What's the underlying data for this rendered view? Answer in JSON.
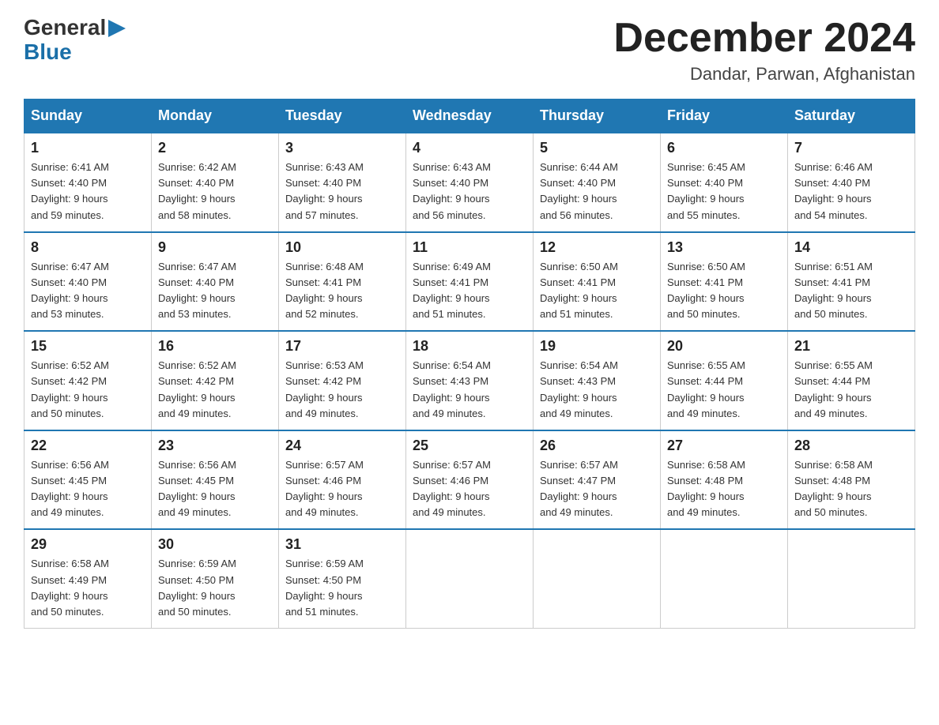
{
  "header": {
    "logo_general": "General",
    "logo_blue": "Blue",
    "month_year": "December 2024",
    "location": "Dandar, Parwan, Afghanistan"
  },
  "weekdays": [
    "Sunday",
    "Monday",
    "Tuesday",
    "Wednesday",
    "Thursday",
    "Friday",
    "Saturday"
  ],
  "weeks": [
    [
      {
        "day": "1",
        "sunrise": "6:41 AM",
        "sunset": "4:40 PM",
        "daylight": "9 hours and 59 minutes."
      },
      {
        "day": "2",
        "sunrise": "6:42 AM",
        "sunset": "4:40 PM",
        "daylight": "9 hours and 58 minutes."
      },
      {
        "day": "3",
        "sunrise": "6:43 AM",
        "sunset": "4:40 PM",
        "daylight": "9 hours and 57 minutes."
      },
      {
        "day": "4",
        "sunrise": "6:43 AM",
        "sunset": "4:40 PM",
        "daylight": "9 hours and 56 minutes."
      },
      {
        "day": "5",
        "sunrise": "6:44 AM",
        "sunset": "4:40 PM",
        "daylight": "9 hours and 56 minutes."
      },
      {
        "day": "6",
        "sunrise": "6:45 AM",
        "sunset": "4:40 PM",
        "daylight": "9 hours and 55 minutes."
      },
      {
        "day": "7",
        "sunrise": "6:46 AM",
        "sunset": "4:40 PM",
        "daylight": "9 hours and 54 minutes."
      }
    ],
    [
      {
        "day": "8",
        "sunrise": "6:47 AM",
        "sunset": "4:40 PM",
        "daylight": "9 hours and 53 minutes."
      },
      {
        "day": "9",
        "sunrise": "6:47 AM",
        "sunset": "4:40 PM",
        "daylight": "9 hours and 53 minutes."
      },
      {
        "day": "10",
        "sunrise": "6:48 AM",
        "sunset": "4:41 PM",
        "daylight": "9 hours and 52 minutes."
      },
      {
        "day": "11",
        "sunrise": "6:49 AM",
        "sunset": "4:41 PM",
        "daylight": "9 hours and 51 minutes."
      },
      {
        "day": "12",
        "sunrise": "6:50 AM",
        "sunset": "4:41 PM",
        "daylight": "9 hours and 51 minutes."
      },
      {
        "day": "13",
        "sunrise": "6:50 AM",
        "sunset": "4:41 PM",
        "daylight": "9 hours and 50 minutes."
      },
      {
        "day": "14",
        "sunrise": "6:51 AM",
        "sunset": "4:41 PM",
        "daylight": "9 hours and 50 minutes."
      }
    ],
    [
      {
        "day": "15",
        "sunrise": "6:52 AM",
        "sunset": "4:42 PM",
        "daylight": "9 hours and 50 minutes."
      },
      {
        "day": "16",
        "sunrise": "6:52 AM",
        "sunset": "4:42 PM",
        "daylight": "9 hours and 49 minutes."
      },
      {
        "day": "17",
        "sunrise": "6:53 AM",
        "sunset": "4:42 PM",
        "daylight": "9 hours and 49 minutes."
      },
      {
        "day": "18",
        "sunrise": "6:54 AM",
        "sunset": "4:43 PM",
        "daylight": "9 hours and 49 minutes."
      },
      {
        "day": "19",
        "sunrise": "6:54 AM",
        "sunset": "4:43 PM",
        "daylight": "9 hours and 49 minutes."
      },
      {
        "day": "20",
        "sunrise": "6:55 AM",
        "sunset": "4:44 PM",
        "daylight": "9 hours and 49 minutes."
      },
      {
        "day": "21",
        "sunrise": "6:55 AM",
        "sunset": "4:44 PM",
        "daylight": "9 hours and 49 minutes."
      }
    ],
    [
      {
        "day": "22",
        "sunrise": "6:56 AM",
        "sunset": "4:45 PM",
        "daylight": "9 hours and 49 minutes."
      },
      {
        "day": "23",
        "sunrise": "6:56 AM",
        "sunset": "4:45 PM",
        "daylight": "9 hours and 49 minutes."
      },
      {
        "day": "24",
        "sunrise": "6:57 AM",
        "sunset": "4:46 PM",
        "daylight": "9 hours and 49 minutes."
      },
      {
        "day": "25",
        "sunrise": "6:57 AM",
        "sunset": "4:46 PM",
        "daylight": "9 hours and 49 minutes."
      },
      {
        "day": "26",
        "sunrise": "6:57 AM",
        "sunset": "4:47 PM",
        "daylight": "9 hours and 49 minutes."
      },
      {
        "day": "27",
        "sunrise": "6:58 AM",
        "sunset": "4:48 PM",
        "daylight": "9 hours and 49 minutes."
      },
      {
        "day": "28",
        "sunrise": "6:58 AM",
        "sunset": "4:48 PM",
        "daylight": "9 hours and 50 minutes."
      }
    ],
    [
      {
        "day": "29",
        "sunrise": "6:58 AM",
        "sunset": "4:49 PM",
        "daylight": "9 hours and 50 minutes."
      },
      {
        "day": "30",
        "sunrise": "6:59 AM",
        "sunset": "4:50 PM",
        "daylight": "9 hours and 50 minutes."
      },
      {
        "day": "31",
        "sunrise": "6:59 AM",
        "sunset": "4:50 PM",
        "daylight": "9 hours and 51 minutes."
      },
      null,
      null,
      null,
      null
    ]
  ]
}
